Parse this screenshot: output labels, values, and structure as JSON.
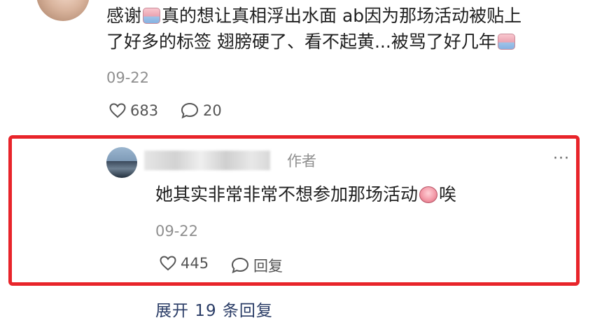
{
  "comment": {
    "text_part1": "感谢",
    "text_part2": "真的想让真相浮出水面 ab因为那场活动被贴上",
    "text_part3": "了好多的标签 翅膀硬了、看不起黄...被骂了好几年",
    "date": "09-22",
    "likes": "683",
    "replies": "20"
  },
  "reply": {
    "author_tag": "作者",
    "more": "···",
    "text_part1": "她其实非常非常不想参加那场活动",
    "text_part2": "唉",
    "date": "09-22",
    "likes": "445",
    "reply_label": "回复"
  },
  "expand_replies": "展开 19 条回复",
  "colors": {
    "highlight_border": "#e8242a",
    "expand_link": "#2a3c66",
    "meta_gray": "#8f8f8f"
  }
}
